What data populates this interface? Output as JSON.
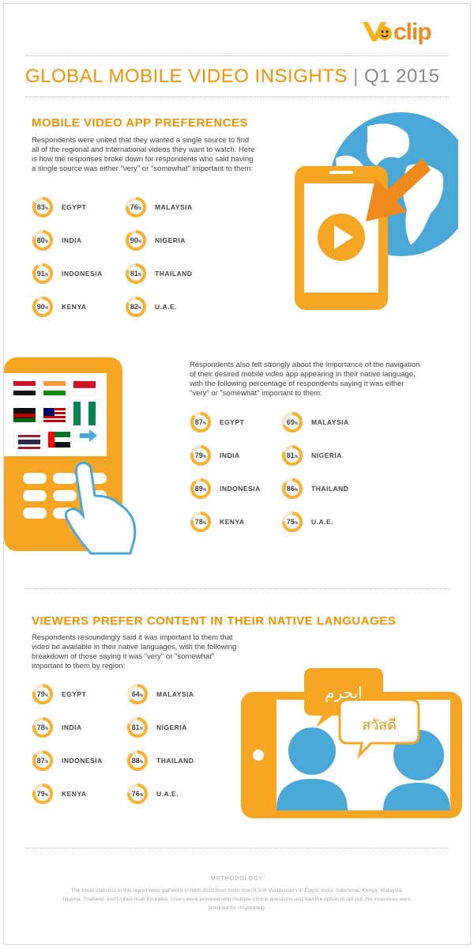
{
  "brand": {
    "logo_text": "clip"
  },
  "header": {
    "title_main": "GLOBAL MOBILE VIDEO INSIGHTS",
    "title_sep": "|",
    "title_period": "Q1 2015"
  },
  "colors": {
    "accent": "#f39200",
    "ring": "#fbb02e",
    "ring_track": "#f3e6c8",
    "phone": "#f6a623",
    "blue": "#4aa8d8"
  },
  "sections": {
    "app_prefs": {
      "title": "MOBILE VIDEO APP PREFERENCES",
      "intro": "Respondents were united that they wanted a single source to find all of the regional and international videos they want to watch. Here is how the responses broke down for respondents who said having a single source was either \"very\" or \"somewhat\" important to them:"
    },
    "navigation": {
      "intro": "Respondents also felt strongly about the importance of the navigation of their desired mobile video app appearing in their native language, with the following percentage of respondents saying it was either \"very\" or \"somewhat\" important to them:"
    },
    "native_lang": {
      "title": "VIEWERS PREFER CONTENT IN THEIR NATIVE LANGUAGES",
      "intro": "Respondents resoundingly said it was important to them that video be available in their native languages, with the following breakdown of those saying it was \"very\" or \"somewhat\" important to them by region:",
      "bubble1": "ابحرم",
      "bubble2": "สวัสดี"
    }
  },
  "pct_symbol": "%",
  "chart_data": [
    {
      "type": "donut",
      "title": "MOBILE VIDEO APP PREFERENCES",
      "categories": [
        "EGYPT",
        "INDIA",
        "INDONESIA",
        "KENYA",
        "MALAYSIA",
        "NIGERIA",
        "THAILAND",
        "U.A.E."
      ],
      "values": [
        83,
        80,
        91,
        90,
        76,
        90,
        81,
        82
      ],
      "unit": "%"
    },
    {
      "type": "donut",
      "title": "",
      "categories": [
        "EGYPT",
        "INDIA",
        "INDONESIA",
        "KENYA",
        "MALAYSIA",
        "NIGERIA",
        "THAILAND",
        "U.A.E."
      ],
      "values": [
        87,
        79,
        89,
        78,
        69,
        81,
        86,
        75
      ],
      "unit": "%"
    },
    {
      "type": "donut",
      "title": "VIEWERS PREFER CONTENT IN THEIR NATIVE LANGUAGES",
      "categories": [
        "EGYPT",
        "INDIA",
        "INDONESIA",
        "KENYA",
        "MALAYSIA",
        "NIGERIA",
        "THAILAND",
        "U.A.E."
      ],
      "values": [
        79,
        78,
        87,
        79,
        64,
        81,
        88,
        76
      ],
      "unit": "%"
    }
  ],
  "methodology": {
    "title": "METHODOLOGY",
    "text": "The trend statistics in this report were gathered in April 2015 from more than 8,500 Vuclip users in Egypt, India, Indonesia, Kenya, Malaysia, Nigeria, Thailand, and United Arab Emirates. Users were provided with multiple-choice questions and had the option to opt out. No incentives were provided for responding."
  }
}
